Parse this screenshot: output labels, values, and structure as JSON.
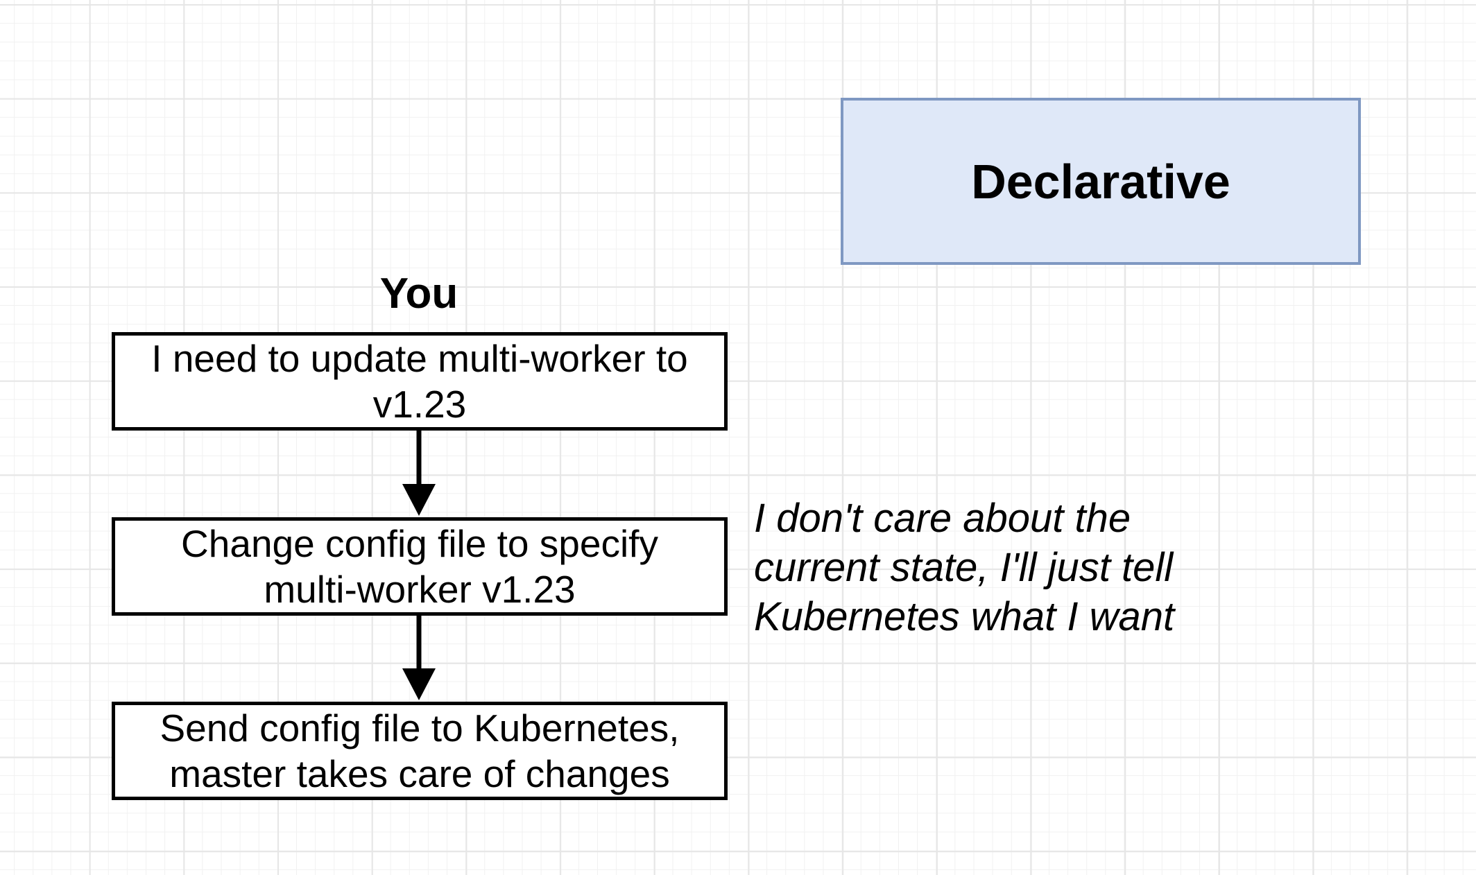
{
  "title": "Declarative",
  "actor": "You",
  "steps": [
    {
      "label": "I need to update multi-worker to v1.23"
    },
    {
      "label": "Change config file to specify multi-worker v1.23"
    },
    {
      "label": "Send config file to Kubernetes, master takes care of changes"
    }
  ],
  "note": "I don't care about the current state, I'll just tell Kubernetes what I want",
  "colors": {
    "title_fill": "#dfe8f8",
    "title_border": "#7f98c2",
    "step_border": "#000000"
  }
}
